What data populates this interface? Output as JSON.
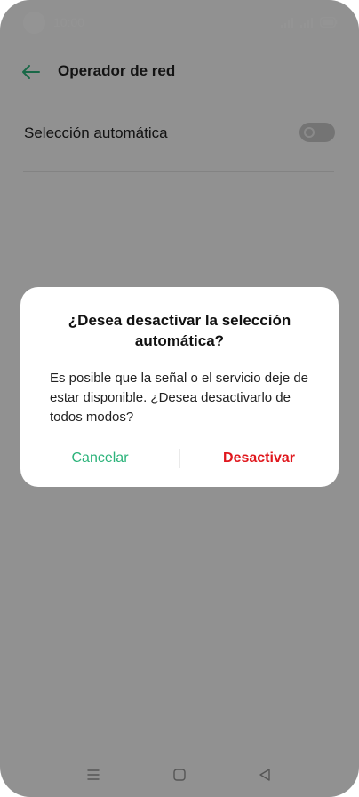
{
  "status_bar": {
    "time": "10:00"
  },
  "header": {
    "title": "Operador de red"
  },
  "settings": {
    "automatic_selection_label": "Selección automática",
    "automatic_selection_on": false
  },
  "dialog": {
    "title": "¿Desea desactivar la selección automática?",
    "message": "Es posible que la señal o el servicio deje de estar disponible. ¿Desea desactivarlo de todos modos?",
    "cancel_label": "Cancelar",
    "confirm_label": "Desactivar"
  },
  "colors": {
    "accent": "#2bb37a",
    "danger": "#e0171d"
  },
  "icons": {
    "back": "arrow-left-icon",
    "menu": "menu-icon",
    "home": "home-icon",
    "nav_back": "triangle-back-icon"
  }
}
